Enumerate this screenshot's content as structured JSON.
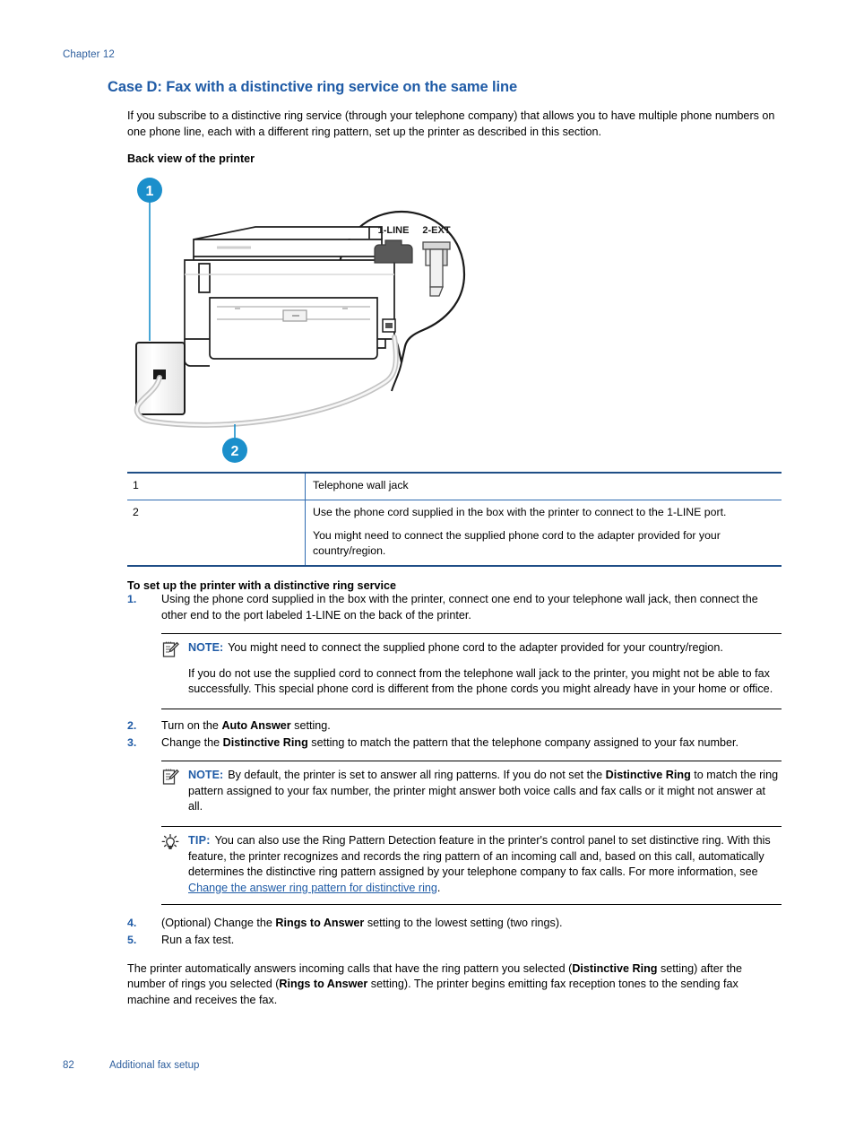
{
  "header": {
    "chapter": "Chapter 12"
  },
  "title": "Case D: Fax with a distinctive ring service on the same line",
  "intro": "If you subscribe to a distinctive ring service (through your telephone company) that allows you to have multiple phone numbers on one phone line, each with a different ring pattern, set up the printer as described in this section.",
  "figure": {
    "caption": "Back view of the printer",
    "port_labels": {
      "line": "1-LINE",
      "ext": "2-EXT"
    },
    "callout_1": "1",
    "callout_2": "2",
    "accent_color": "#1b8fcb"
  },
  "legend_table": {
    "rows": [
      {
        "num": "1",
        "lines": [
          "Telephone wall jack"
        ]
      },
      {
        "num": "2",
        "lines": [
          "Use the phone cord supplied in the box with the printer to connect to the 1-LINE port.",
          "You might need to connect the supplied phone cord to the adapter provided for your country/region."
        ]
      }
    ]
  },
  "procedure": {
    "heading": "To set up the printer with a distinctive ring service",
    "steps": [
      {
        "marker": "1.",
        "text": "Using the phone cord supplied in the box with the printer, connect one end to your telephone wall jack, then connect the other end to the port labeled 1-LINE on the back of the printer."
      },
      {
        "marker": "2.",
        "text_pre": "Turn on the ",
        "bold": "Auto Answer",
        "text_post": " setting."
      },
      {
        "marker": "3.",
        "text_pre": "Change the ",
        "bold": "Distinctive Ring",
        "text_post": " setting to match the pattern that the telephone company assigned to your fax number."
      },
      {
        "marker": "4.",
        "text_pre": "(Optional) Change the ",
        "bold": "Rings to Answer",
        "text_post": " setting to the lowest setting (two rings)."
      },
      {
        "marker": "5.",
        "text": "Run a fax test."
      }
    ]
  },
  "note_1": {
    "icon": "note-icon",
    "label": "NOTE:",
    "text": "You might need to connect the supplied phone cord to the adapter provided for your country/region."
  },
  "note_1_extra": "If you do not use the supplied cord to connect from the telephone wall jack to the printer, you might not be able to fax successfully. This special phone cord is different from the phone cords you might already have in your home or office.",
  "note_2": {
    "icon": "note-icon",
    "label": "NOTE:",
    "text_pre": "By default, the printer is set to answer all ring patterns. If you do not set the ",
    "bold": "Distinctive Ring",
    "text_post": " to match the ring pattern assigned to your fax number, the printer might answer both voice calls and fax calls or it might not answer at all."
  },
  "tip": {
    "icon": "lightbulb-icon",
    "label": "TIP:",
    "text_pre": "You can also use the Ring Pattern Detection feature in the printer's control panel to set distinctive ring. With this feature, the printer recognizes and records the ring pattern of an incoming call and, based on this call, automatically determines the distinctive ring pattern assigned by your telephone company to fax calls. For more information, see ",
    "link": "Change the answer ring pattern for distinctive ring",
    "text_post": "."
  },
  "closing": {
    "pre": "The printer automatically answers incoming calls that have the ring pattern you selected (",
    "bold1": "Distinctive Ring",
    "mid": " setting) after the number of rings you selected (",
    "bold2": "Rings to Answer",
    "post": " setting). The printer begins emitting fax reception tones to the sending fax machine and receives the fax."
  },
  "footer": {
    "page_number": "82",
    "section": "Additional fax setup"
  }
}
